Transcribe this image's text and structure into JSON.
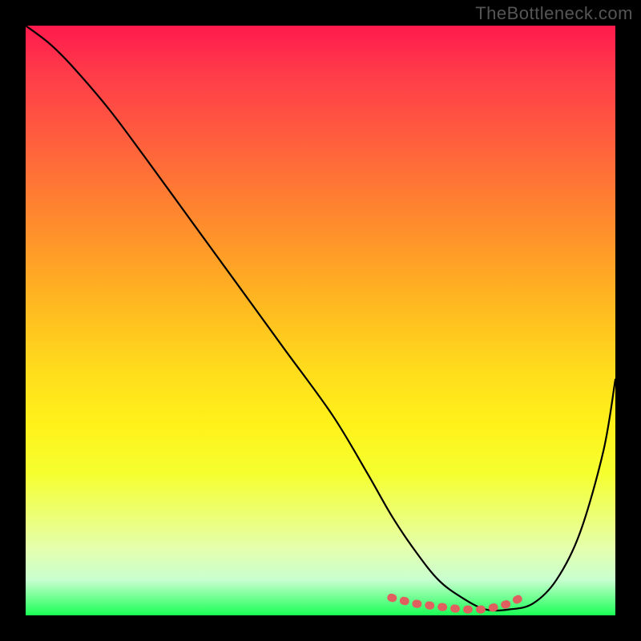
{
  "watermark": "TheBottleneck.com",
  "colors": {
    "background": "#000000",
    "gradient_top": "#ff1a4d",
    "gradient_bottom": "#1aff55",
    "curve_stroke": "#000000",
    "marker_stroke": "#e06060"
  },
  "chart_data": {
    "type": "line",
    "title": "",
    "xlabel": "",
    "ylabel": "",
    "xlim": [
      0,
      100
    ],
    "ylim": [
      0,
      100
    ],
    "grid": false,
    "legend": false,
    "annotations": [
      "TheBottleneck.com"
    ],
    "series": [
      {
        "name": "bottleneck-curve",
        "x": [
          0,
          4,
          8,
          14,
          20,
          28,
          36,
          44,
          52,
          58,
          62,
          66,
          70,
          74,
          78,
          82,
          86,
          90,
          94,
          98,
          100
        ],
        "y": [
          100,
          97,
          93,
          86,
          78,
          67,
          56,
          45,
          34,
          24,
          17,
          11,
          6,
          3,
          1,
          1,
          2,
          6,
          14,
          28,
          40
        ]
      }
    ],
    "highlight": {
      "name": "optimal-range-markers",
      "x": [
        62,
        66,
        70,
        74,
        78,
        82,
        84
      ],
      "y": [
        3,
        2,
        1.5,
        1,
        1,
        2,
        3
      ]
    }
  }
}
